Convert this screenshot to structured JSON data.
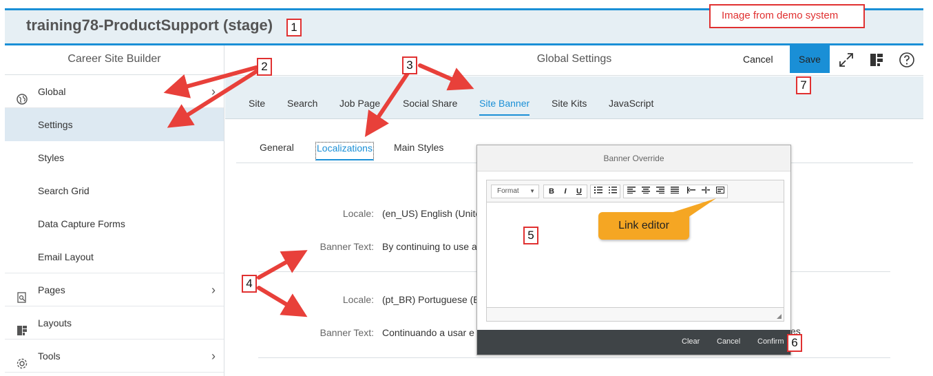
{
  "header": {
    "app_title": "training78-ProductSupport (stage)",
    "demo_note": "Image from demo system"
  },
  "sidebar": {
    "title": "Career Site Builder",
    "items": [
      {
        "label": "Global",
        "icon": "globe-icon",
        "expandable": true
      },
      {
        "label": "Settings",
        "sub": true,
        "active": true
      },
      {
        "label": "Styles",
        "sub": true
      },
      {
        "label": "Search Grid",
        "sub": true
      },
      {
        "label": "Data Capture Forms",
        "sub": true
      },
      {
        "label": "Email Layout",
        "sub": true
      },
      {
        "label": "Pages",
        "icon": "pages-search-icon",
        "expandable": true
      },
      {
        "label": "Layouts",
        "icon": "layout-icon",
        "expandable": false
      },
      {
        "label": "Tools",
        "icon": "gear-icon",
        "expandable": true
      }
    ]
  },
  "main": {
    "title": "Global Settings",
    "cancel_label": "Cancel",
    "save_label": "Save",
    "tabs": [
      "Site",
      "Search",
      "Job Page",
      "Social Share",
      "Site Banner",
      "Site Kits",
      "JavaScript"
    ],
    "active_tab": "Site Banner",
    "subtabs": [
      "General",
      "Localizations",
      "Main Styles"
    ],
    "active_subtab": "Localizations",
    "rows": [
      {
        "locale_label": "Locale:",
        "locale_value": "(en_US) English (Unite",
        "banner_label": "Banner Text:",
        "banner_value": "By continuing to use a"
      },
      {
        "locale_label": "Locale:",
        "locale_value": "(pt_BR) Portuguese (B",
        "banner_label": "Banner Text:",
        "banner_value": "Continuando a usar e",
        "banner_tail": "es"
      }
    ]
  },
  "modal": {
    "title": "Banner Override",
    "format_label": "Format",
    "buttons": {
      "clear": "Clear",
      "cancel": "Cancel",
      "confirm": "Confirm"
    }
  },
  "tooltip": "Link editor",
  "callouts": [
    "1",
    "2",
    "3",
    "4",
    "5",
    "6",
    "7"
  ],
  "colors": {
    "accent": "#1a8fd6",
    "callout": "#e03030",
    "tooltip": "#f5a623"
  }
}
